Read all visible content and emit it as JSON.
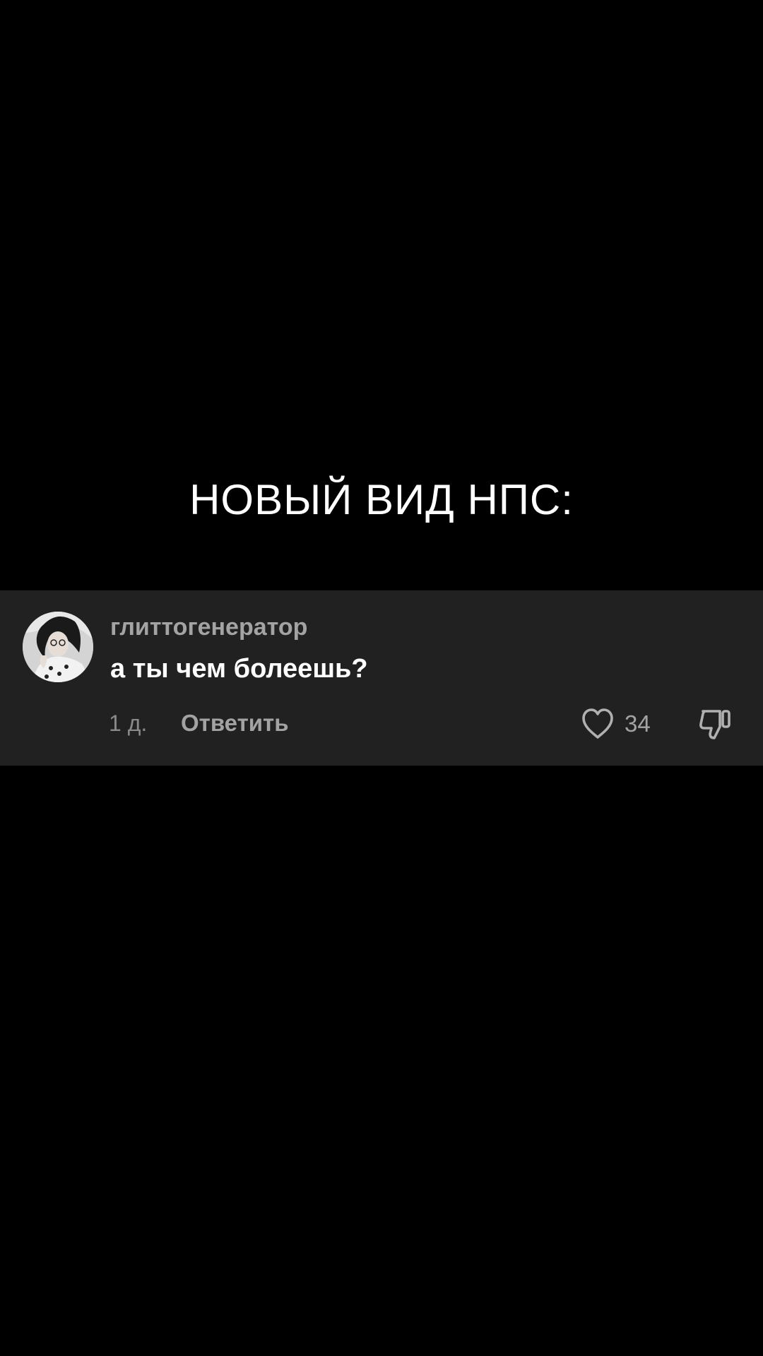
{
  "caption": "НОВЫЙ ВИД НПС:",
  "comment": {
    "username": "глиттогенератор",
    "text": "а ты чем болеешь?",
    "time": "1 д.",
    "reply_label": "Ответить",
    "like_count": "34"
  },
  "icons": {
    "like": "heart-outline-icon",
    "dislike": "thumbs-down-outline-icon"
  },
  "colors": {
    "background": "#000000",
    "card": "#212121",
    "text_primary": "#ffffff",
    "text_secondary": "#a3a3a3"
  }
}
